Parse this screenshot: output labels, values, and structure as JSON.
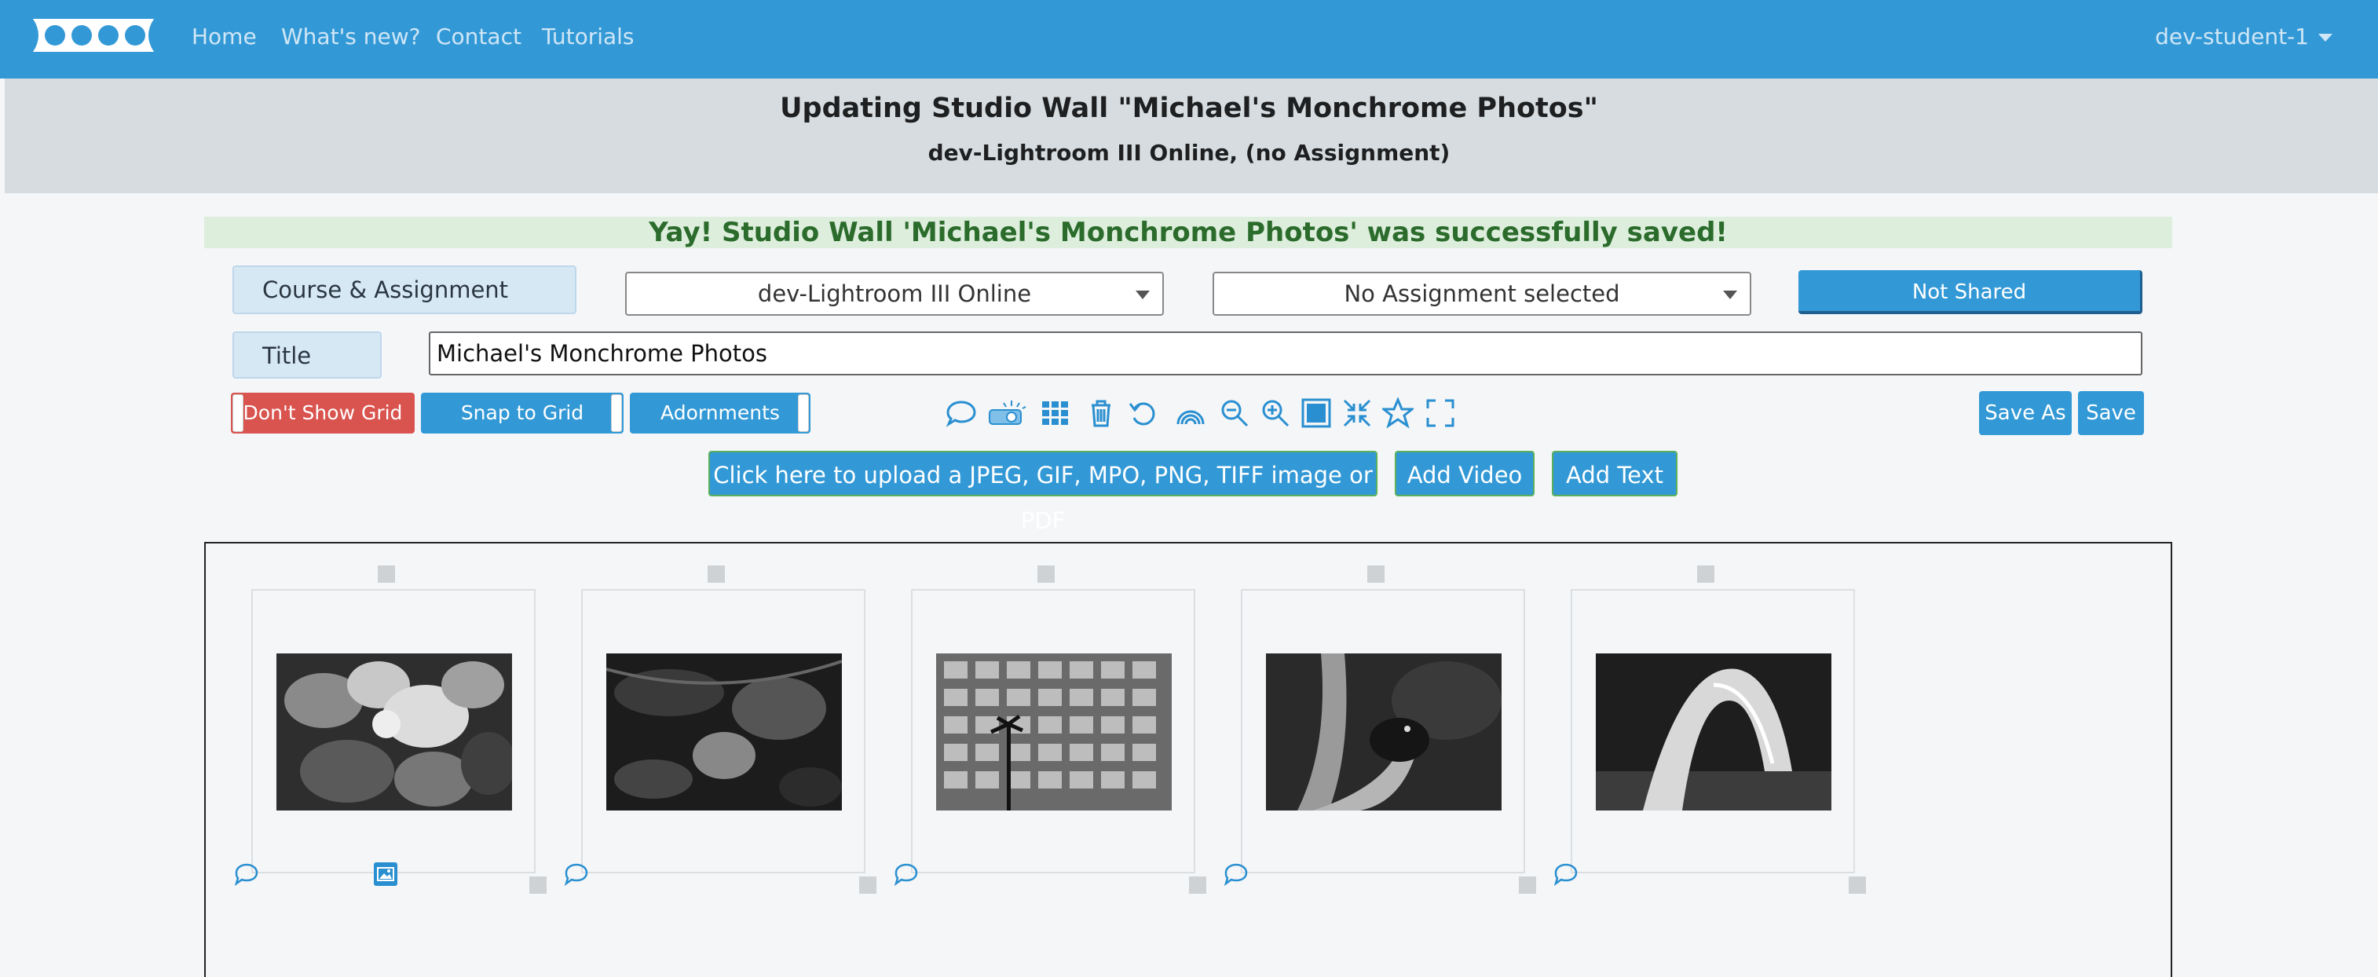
{
  "nav": {
    "links": [
      "Home",
      "What's new?",
      "Contact",
      "Tutorials"
    ],
    "user": "dev-student-1"
  },
  "header": {
    "title": "Updating Studio Wall \"Michael's Monchrome Photos\"",
    "subtitle": "dev-Lightroom III Online, (no Assignment)"
  },
  "alert": "Yay! Studio Wall 'Michael's Monchrome Photos' was successfully saved!",
  "form": {
    "course_label": "Course & Assignment",
    "course_value": "dev-Lightroom III Online",
    "assignment_value": "No Assignment selected",
    "share_button": "Not Shared",
    "title_label": "Title",
    "title_value": "Michael's Monchrome Photos"
  },
  "toolbar": {
    "toggles": [
      "Don't Show Grid",
      "Snap to Grid",
      "Adornments"
    ],
    "icons": [
      "comment-icon",
      "projector-icon",
      "grid-icon",
      "trash-icon",
      "undo-icon",
      "rainbow-icon",
      "zoom-out-icon",
      "zoom-in-icon",
      "square-icon",
      "compress-icon",
      "star-icon",
      "fullscreen-icon"
    ],
    "save_as": "Save As",
    "save": "Save"
  },
  "upload": {
    "upload_button": "Click here to upload a JPEG, GIF, MPO, PNG, TIFF image or PDF",
    "video_button": "Add Video",
    "text_button": "Add Text"
  },
  "wall": {
    "photos": [
      {
        "subject": "flowers and leaves"
      },
      {
        "subject": "dark foliage"
      },
      {
        "subject": "building facade with palm"
      },
      {
        "subject": "bird on patterned trunk"
      },
      {
        "subject": "water fountain arc"
      }
    ]
  },
  "colors": {
    "primary": "#3399d6",
    "danger": "#d9534f",
    "alert_bg": "#ddeedd",
    "alert_text": "#2b6b2b",
    "header_bg": "#d6dcdf"
  }
}
